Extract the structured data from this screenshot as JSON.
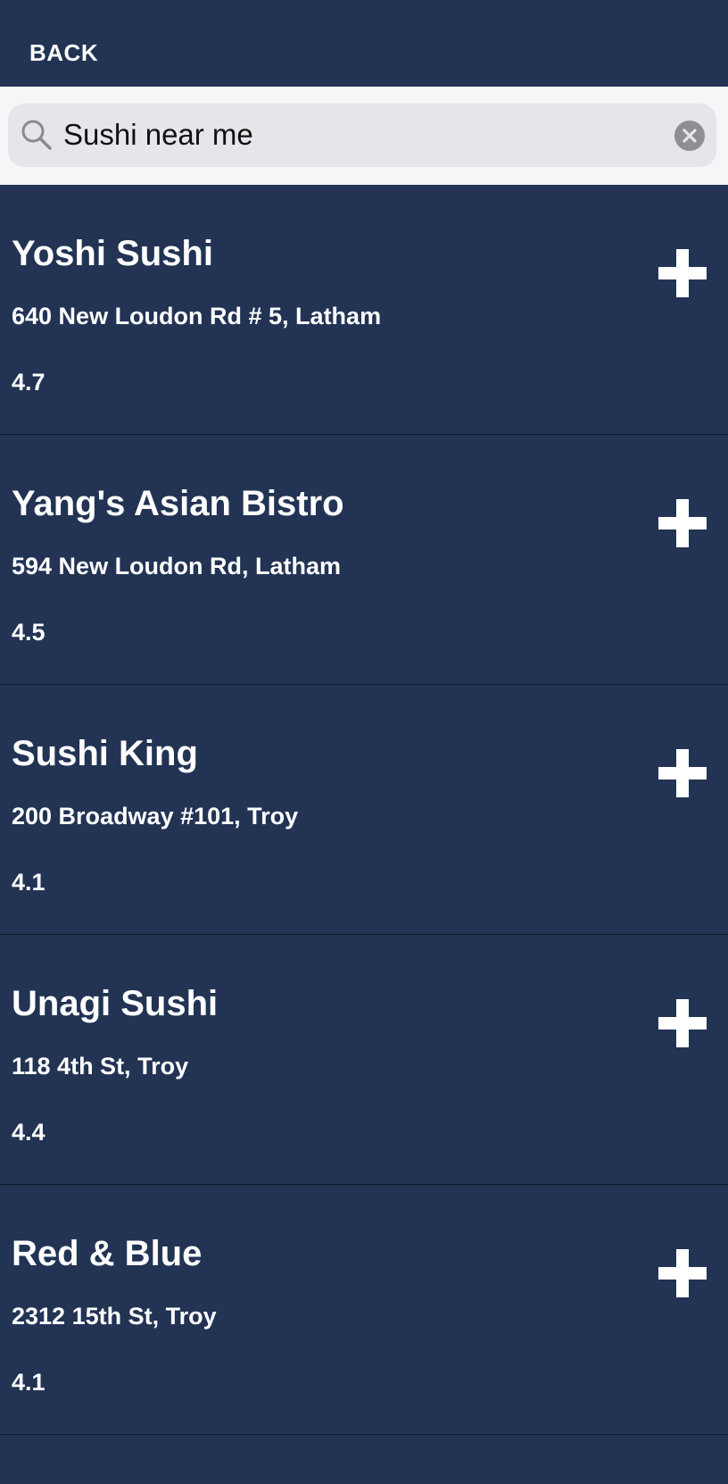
{
  "header": {
    "back_label": "BACK"
  },
  "search": {
    "query": "Sushi near me",
    "icon": "search-icon",
    "clear_icon": "clear-icon"
  },
  "colors": {
    "background": "#223354",
    "search_bar_bg": "#f5f6f8",
    "search_field_bg": "#e5e6ea",
    "text": "#ffffff",
    "divider": "#0f172a"
  },
  "results": [
    {
      "name": "Yoshi Sushi",
      "address": "640 New Loudon Rd # 5,  Latham",
      "rating": "4.7"
    },
    {
      "name": "Yang's Asian Bistro",
      "address": "594 New Loudon Rd,  Latham",
      "rating": "4.5"
    },
    {
      "name": "Sushi King",
      "address": "200 Broadway #101,  Troy",
      "rating": "4.1"
    },
    {
      "name": "Unagi Sushi",
      "address": "118 4th St,  Troy",
      "rating": "4.4"
    },
    {
      "name": "Red & Blue",
      "address": "2312 15th St,  Troy",
      "rating": "4.1"
    }
  ]
}
